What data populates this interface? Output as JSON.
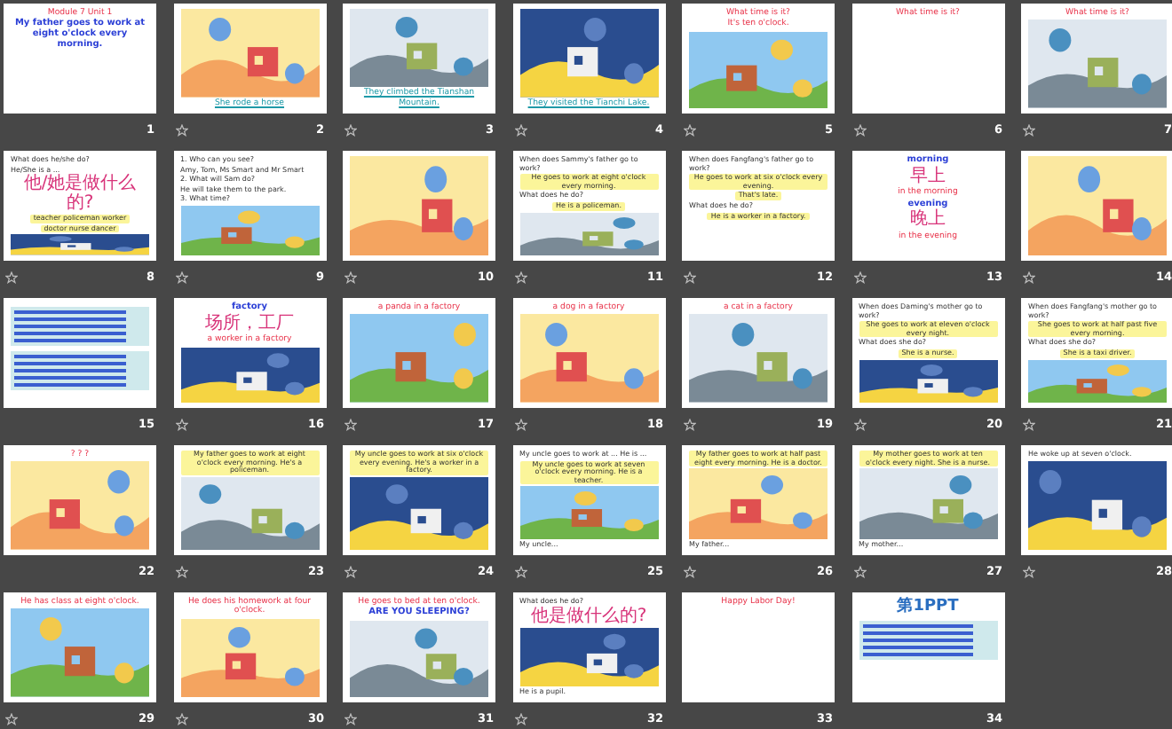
{
  "slides": [
    {
      "number": "1",
      "animated": false,
      "content": [
        {
          "kind": "title",
          "text": "Module 7 Unit 1"
        },
        {
          "kind": "heading",
          "text": "My father goes to work at eight o'clock every morning."
        }
      ]
    },
    {
      "number": "2",
      "animated": true,
      "content": [
        {
          "kind": "picture"
        },
        {
          "kind": "link",
          "text": "She rode a horse"
        }
      ]
    },
    {
      "number": "3",
      "animated": true,
      "content": [
        {
          "kind": "picture"
        },
        {
          "kind": "link",
          "text": "They climbed the Tianshan Mountain."
        }
      ]
    },
    {
      "number": "4",
      "animated": true,
      "content": [
        {
          "kind": "picture"
        },
        {
          "kind": "link",
          "text": "They visited the Tianchi Lake."
        }
      ]
    },
    {
      "number": "5",
      "animated": true,
      "content": [
        {
          "kind": "title",
          "text": "What time is it?"
        },
        {
          "kind": "title",
          "text": "It's ten o'clock."
        },
        {
          "kind": "picture"
        }
      ]
    },
    {
      "number": "6",
      "animated": true,
      "content": [
        {
          "kind": "title",
          "text": "What time is it?"
        }
      ]
    },
    {
      "number": "7",
      "animated": true,
      "content": [
        {
          "kind": "title",
          "text": "What time is it?"
        },
        {
          "kind": "picture"
        }
      ]
    },
    {
      "number": "8",
      "animated": true,
      "content": [
        {
          "kind": "body",
          "text": "What does he/she do?"
        },
        {
          "kind": "body",
          "text": "He/She is a ..."
        },
        {
          "kind": "cjk",
          "text": "他/她是做什么的?"
        },
        {
          "kind": "note",
          "text": "teacher  policeman  worker"
        },
        {
          "kind": "note",
          "text": "doctor  nurse  dancer"
        },
        {
          "kind": "picture"
        }
      ]
    },
    {
      "number": "9",
      "animated": true,
      "content": [
        {
          "kind": "body",
          "text": "1. Who can you see?"
        },
        {
          "kind": "body",
          "text": "Amy, Tom, Ms Smart and Mr Smart"
        },
        {
          "kind": "body",
          "text": "2. What will Sam do?"
        },
        {
          "kind": "body",
          "text": "He will take them to the park."
        },
        {
          "kind": "body",
          "text": "3. What time?"
        },
        {
          "kind": "picture"
        }
      ]
    },
    {
      "number": "10",
      "animated": true,
      "content": [
        {
          "kind": "picture"
        }
      ]
    },
    {
      "number": "11",
      "animated": true,
      "content": [
        {
          "kind": "body",
          "text": "When does Sammy's father go to work?"
        },
        {
          "kind": "note",
          "text": "He goes to work at eight o'clock every morning."
        },
        {
          "kind": "body",
          "text": "What does he do?"
        },
        {
          "kind": "note",
          "text": "He is a policeman."
        },
        {
          "kind": "picture"
        }
      ]
    },
    {
      "number": "12",
      "animated": true,
      "content": [
        {
          "kind": "body",
          "text": "When does Fangfang's father go to work?"
        },
        {
          "kind": "note",
          "text": "He goes to work at six o'clock every evening."
        },
        {
          "kind": "note",
          "text": "That's late."
        },
        {
          "kind": "body",
          "text": "What does he do?"
        },
        {
          "kind": "note",
          "text": "He is a worker in a factory."
        }
      ]
    },
    {
      "number": "13",
      "animated": true,
      "content": [
        {
          "kind": "heading",
          "text": "morning"
        },
        {
          "kind": "cjk",
          "text": "早上"
        },
        {
          "kind": "title",
          "text": "in the morning"
        },
        {
          "kind": "heading",
          "text": "evening"
        },
        {
          "kind": "cjk",
          "text": "晚上"
        },
        {
          "kind": "title",
          "text": "in the evening"
        }
      ]
    },
    {
      "number": "14",
      "animated": true,
      "content": [
        {
          "kind": "picture"
        }
      ]
    },
    {
      "number": "15",
      "animated": false,
      "content": [
        {
          "kind": "lines"
        },
        {
          "kind": "lines"
        }
      ]
    },
    {
      "number": "16",
      "animated": true,
      "content": [
        {
          "kind": "heading",
          "text": "factory"
        },
        {
          "kind": "cjk",
          "text": "场所，工厂"
        },
        {
          "kind": "title",
          "text": "a worker in a factory"
        },
        {
          "kind": "picture"
        }
      ]
    },
    {
      "number": "17",
      "animated": true,
      "content": [
        {
          "kind": "title",
          "text": "a panda in a factory"
        },
        {
          "kind": "picture"
        }
      ]
    },
    {
      "number": "18",
      "animated": true,
      "content": [
        {
          "kind": "title",
          "text": "a dog in a factory"
        },
        {
          "kind": "picture"
        }
      ]
    },
    {
      "number": "19",
      "animated": true,
      "content": [
        {
          "kind": "title",
          "text": "a cat in a factory"
        },
        {
          "kind": "picture"
        }
      ]
    },
    {
      "number": "20",
      "animated": true,
      "content": [
        {
          "kind": "body",
          "text": "When does Daming's mother go to work?"
        },
        {
          "kind": "note",
          "text": "She goes to work at eleven o'clock every night."
        },
        {
          "kind": "body",
          "text": "What does she do?"
        },
        {
          "kind": "note",
          "text": "She is a nurse."
        },
        {
          "kind": "picture"
        }
      ]
    },
    {
      "number": "21",
      "animated": true,
      "content": [
        {
          "kind": "body",
          "text": "When does Fangfang's mother go to work?"
        },
        {
          "kind": "note",
          "text": "She goes to work at half past five every morning."
        },
        {
          "kind": "body",
          "text": "What does she do?"
        },
        {
          "kind": "note",
          "text": "She is a taxi driver."
        },
        {
          "kind": "picture"
        }
      ]
    },
    {
      "number": "22",
      "animated": false,
      "content": [
        {
          "kind": "title",
          "text": "? ? ?"
        },
        {
          "kind": "picture"
        }
      ]
    },
    {
      "number": "23",
      "animated": true,
      "content": [
        {
          "kind": "note",
          "text": "My father goes to work at eight o'clock every morning. He's a policeman."
        },
        {
          "kind": "picture"
        }
      ]
    },
    {
      "number": "24",
      "animated": true,
      "content": [
        {
          "kind": "note",
          "text": "My uncle goes to work at six o'clock every evening. He's a worker in a factory."
        },
        {
          "kind": "picture"
        }
      ]
    },
    {
      "number": "25",
      "animated": true,
      "content": [
        {
          "kind": "body",
          "text": "My uncle goes to work at ... He is ..."
        },
        {
          "kind": "note",
          "text": "My uncle goes to work at seven o'clock every morning. He is a teacher."
        },
        {
          "kind": "picture"
        },
        {
          "kind": "body",
          "text": "My uncle..."
        }
      ]
    },
    {
      "number": "26",
      "animated": true,
      "content": [
        {
          "kind": "note",
          "text": "My father goes to work at half past eight every morning. He is a doctor."
        },
        {
          "kind": "picture"
        },
        {
          "kind": "body",
          "text": "My father..."
        }
      ]
    },
    {
      "number": "27",
      "animated": true,
      "content": [
        {
          "kind": "note",
          "text": "My mother goes to work at ten o'clock every night. She is a nurse."
        },
        {
          "kind": "picture"
        },
        {
          "kind": "body",
          "text": "My mother..."
        }
      ]
    },
    {
      "number": "28",
      "animated": true,
      "content": [
        {
          "kind": "body",
          "text": "He woke up at seven o'clock."
        },
        {
          "kind": "picture"
        }
      ]
    },
    {
      "number": "29",
      "animated": true,
      "content": [
        {
          "kind": "title",
          "text": "He has class at eight o'clock."
        },
        {
          "kind": "picture"
        }
      ]
    },
    {
      "number": "30",
      "animated": true,
      "content": [
        {
          "kind": "title",
          "text": "He does his homework at four o'clock."
        },
        {
          "kind": "picture"
        }
      ]
    },
    {
      "number": "31",
      "animated": true,
      "content": [
        {
          "kind": "title",
          "text": "He goes to bed at ten o'clock."
        },
        {
          "kind": "heading",
          "text": "ARE YOU SLEEPING?"
        },
        {
          "kind": "picture"
        }
      ]
    },
    {
      "number": "32",
      "animated": true,
      "content": [
        {
          "kind": "body",
          "text": "What does he do?"
        },
        {
          "kind": "cjk",
          "text": "他是做什么的?"
        },
        {
          "kind": "picture"
        },
        {
          "kind": "body",
          "text": "He is a pupil."
        }
      ]
    },
    {
      "number": "33",
      "animated": false,
      "content": [
        {
          "kind": "title",
          "text": "Happy Labor Day!"
        }
      ]
    },
    {
      "number": "34",
      "animated": false,
      "content": [
        {
          "kind": "logo",
          "text": "第1PPT"
        },
        {
          "kind": "lines"
        }
      ]
    }
  ]
}
